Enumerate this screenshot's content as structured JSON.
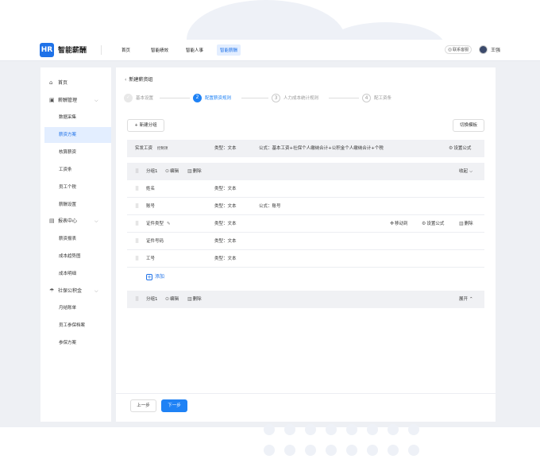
{
  "header": {
    "brand": "智能薪酬",
    "logo_text": "HR",
    "nav": [
      "首页",
      "智能绩效",
      "智能人事",
      "智能薪酬"
    ],
    "active_nav": "智能薪酬",
    "support": "联系客服",
    "user": "王强"
  },
  "sidebar": {
    "items": [
      {
        "label": "首页",
        "icon": "home-icon"
      },
      {
        "label": "薪酬管理",
        "icon": "wallet-icon"
      },
      {
        "label": "报表中心",
        "icon": "report-icon"
      },
      {
        "label": "社保公积金",
        "icon": "umbrella-icon"
      }
    ],
    "salary_subs": [
      "数据采集",
      "薪资方案",
      "核算薪资",
      "工资条",
      "员工个税",
      "薪酬设置"
    ],
    "report_subs": [
      "薪资报表",
      "成本趋势图",
      "成本明细"
    ],
    "social_subs": [
      "月结账单",
      "员工参保档案",
      "参保方案"
    ],
    "active_sub": "薪资方案"
  },
  "main": {
    "breadcrumb": "新建薪资组",
    "steps": [
      {
        "num": "✓",
        "label": "基本设置",
        "state": "done"
      },
      {
        "num": "2",
        "label": "配置薪资规则",
        "state": "active"
      },
      {
        "num": "3",
        "label": "人力成本统计规则",
        "state": "todo"
      },
      {
        "num": "4",
        "label": "配工资条",
        "state": "todo"
      }
    ],
    "new_group_button": "+ 新建分组",
    "switch_template_button": "切换模板",
    "summary_row": {
      "name": "实发工资",
      "tag": "控制项",
      "type": "类型：文本",
      "formula": "公式：基本工资+社保个人缴纳合计+公积金个人缴纳合计+个税",
      "set_formula": "设置公式"
    },
    "group1": {
      "name": "分组1",
      "edit": "编辑",
      "delete": "删除",
      "toggle": "收起"
    },
    "fields": [
      {
        "name": "姓名",
        "type": "类型：文本",
        "formula": ""
      },
      {
        "name": "账号",
        "type": "类型：文本",
        "formula": "公式：账号"
      },
      {
        "name": "证件类型",
        "type": "类型：文本",
        "formula": ""
      },
      {
        "name": "证件号码",
        "type": "类型：文本",
        "formula": ""
      },
      {
        "name": "工号",
        "type": "类型：文本",
        "formula": ""
      }
    ],
    "row_actions": {
      "move": "移动到",
      "set_formula": "设置公式",
      "delete": "删除"
    },
    "add_label": "添加",
    "group2": {
      "name": "分组1",
      "edit": "编辑",
      "delete": "删除",
      "toggle": "展开"
    },
    "prev_button": "上一步",
    "next_button": "下一步"
  },
  "colors": {
    "accent": "#1f82f5",
    "background": "#eef0f4"
  }
}
